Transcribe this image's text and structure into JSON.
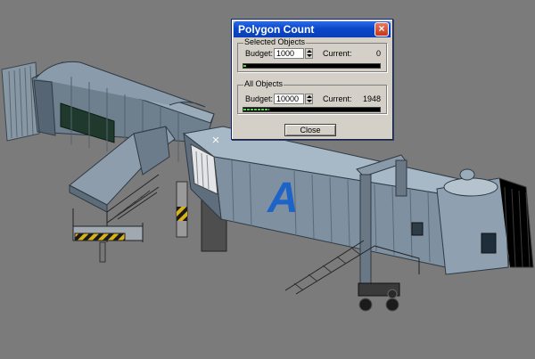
{
  "viewport": {
    "background": "#7b7b7b",
    "jetway_body_color": "#7d8fa0",
    "jetway_dark": "#4e5d6b",
    "jetway_light": "#aabbc8",
    "sign_letter": "A",
    "sign_letter_color": "#1e63c8"
  },
  "dialog": {
    "title": "Polygon Count",
    "close_glyph": "×",
    "selected_group": {
      "label": "Selected Objects",
      "budget_label": "Budget:",
      "budget_value": "1000",
      "current_label": "Current:",
      "current_value": "0",
      "progress_fraction": 0.02
    },
    "all_group": {
      "label": "All Objects",
      "budget_label": "Budget:",
      "budget_value": "10000",
      "current_label": "Current:",
      "current_value": "1948",
      "progress_fraction": 0.19
    },
    "close_button_label": "Close"
  }
}
